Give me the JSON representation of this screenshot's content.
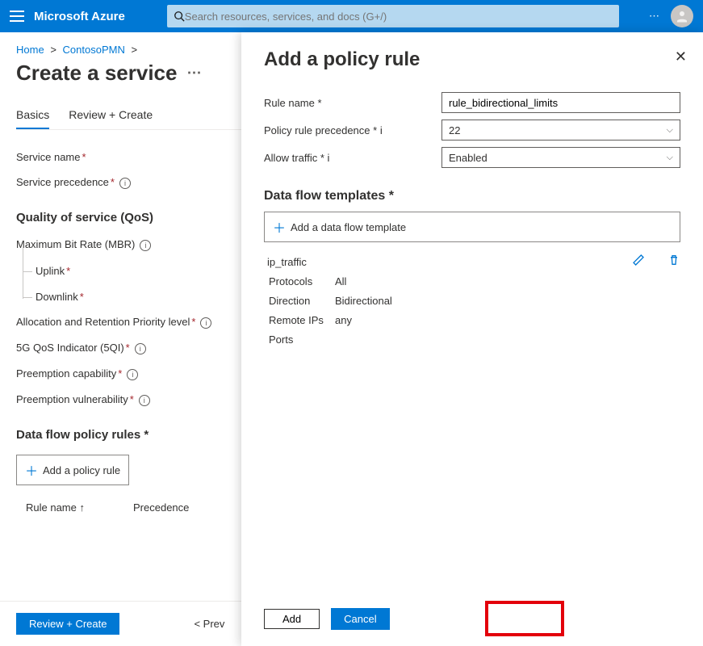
{
  "header": {
    "brand": "Microsoft Azure",
    "search_placeholder": "Search resources, services, and docs (G+/)"
  },
  "breadcrumb": {
    "home": "Home",
    "ctx": "ContosoPMN"
  },
  "page": {
    "title": "Create a service",
    "tabs": {
      "basics": "Basics",
      "review": "Review + Create"
    },
    "labels": {
      "service_name": "Service name",
      "service_precedence": "Service precedence",
      "qos_heading": "Quality of service (QoS)",
      "mbr": "Maximum Bit Rate (MBR)",
      "uplink": "Uplink",
      "downlink": "Downlink",
      "arp": "Allocation and Retention Priority level",
      "fiveg": "5G QoS Indicator (5QI)",
      "preempt_cap": "Preemption capability",
      "preempt_vul": "Preemption vulnerability",
      "rules_heading": "Data flow policy rules",
      "add_rule": "Add a policy rule",
      "col_rule": "Rule name",
      "col_prec": "Precedence"
    },
    "footer": {
      "review": "Review + Create",
      "prev": "< Prev"
    }
  },
  "panel": {
    "title": "Add a policy rule",
    "labels": {
      "rule_name": "Rule name",
      "precedence": "Policy rule precedence",
      "allow": "Allow traffic",
      "dft_heading": "Data flow templates",
      "add_dft": "Add a data flow template"
    },
    "values": {
      "rule_name": "rule_bidirectional_limits",
      "precedence": "22",
      "allow": "Enabled"
    },
    "template": {
      "name": "ip_traffic",
      "protocols_l": "Protocols",
      "protocols": "All",
      "direction_l": "Direction",
      "direction": "Bidirectional",
      "remote_l": "Remote IPs",
      "remote": "any",
      "ports_l": "Ports",
      "ports": ""
    },
    "footer": {
      "add": "Add",
      "cancel": "Cancel"
    }
  }
}
